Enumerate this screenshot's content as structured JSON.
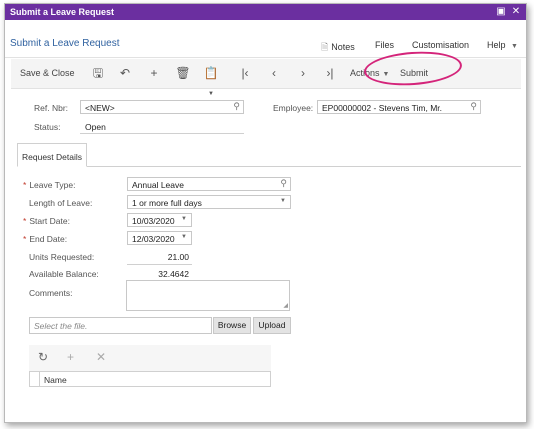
{
  "window": {
    "title": "Submit a Leave Request",
    "restore_icon": "restore-icon",
    "close_icon": "close-icon"
  },
  "header": {
    "page_title": "Submit a Leave Request",
    "notes": "Notes",
    "files": "Files",
    "customisation": "Customisation",
    "help": "Help"
  },
  "toolbar": {
    "save_close": "Save & Close",
    "actions": "Actions",
    "submit": "Submit",
    "icons": [
      "save-icon",
      "undo-icon",
      "add-icon",
      "delete-icon",
      "copy-paste-icon",
      "first-record-icon",
      "previous-icon",
      "next-icon",
      "last-record-icon"
    ]
  },
  "summary": {
    "ref_nbr_label": "Ref. Nbr:",
    "ref_nbr_value": "<NEW>",
    "status_label": "Status:",
    "status_value": "Open",
    "employee_label": "Employee:",
    "employee_value": "EP00000002 - Stevens Tim, Mr."
  },
  "tabs": [
    {
      "label": "Request Details",
      "active": true
    }
  ],
  "details": {
    "leave_type_label": "Leave Type:",
    "leave_type_value": "Annual Leave",
    "length_label": "Length of Leave:",
    "length_value": "1 or more full days",
    "start_date_label": "Start Date:",
    "start_date_value": "10/03/2020",
    "end_date_label": "End Date:",
    "end_date_value": "12/03/2020",
    "units_label": "Units Requested:",
    "units_value": "21.00",
    "balance_label": "Available Balance:",
    "balance_value": "32.4642",
    "comments_label": "Comments:",
    "comments_value": ""
  },
  "attachments": {
    "file_placeholder": "Select the file.",
    "browse": "Browse",
    "upload": "Upload"
  },
  "grid": {
    "columns": [
      "Name"
    ]
  },
  "colors": {
    "titlebar": "#6b2fa0",
    "link": "#3062a0",
    "highlight_circle": "#d4247a",
    "required_marker": "#c0392b"
  }
}
